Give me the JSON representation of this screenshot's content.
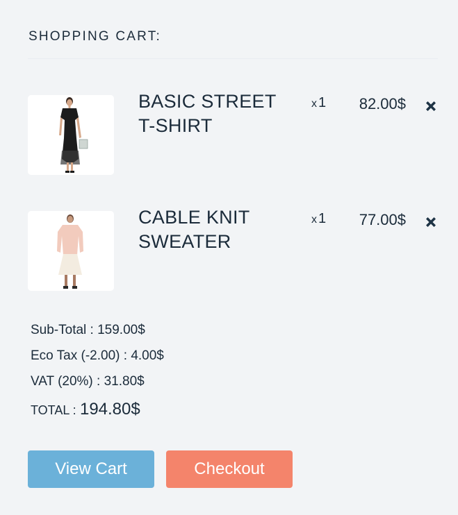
{
  "cart": {
    "title": "SHOPPING CART:",
    "items": [
      {
        "name_line1": "BASIC STREET",
        "name_line2": "T-SHIRT",
        "qty_prefix": "x",
        "qty": "1",
        "price": "82.00$",
        "remove_icon": "close-x-icon"
      },
      {
        "name_line1": "CABLE KNIT",
        "name_line2": "SWEATER",
        "qty_prefix": "x",
        "qty": "1",
        "price": "77.00$",
        "remove_icon": "close-x-icon"
      }
    ],
    "totals": {
      "subtotal_label": "Sub-Total :",
      "subtotal_value": "159.00$",
      "ecotax_label": "Eco Tax (-2.00) :",
      "ecotax_value": "4.00$",
      "vat_label": "VAT (20%) :",
      "vat_value": "31.80$",
      "total_label": "TOTAL :",
      "total_value": "194.80$"
    },
    "buttons": {
      "view_cart": "View Cart",
      "checkout": "Checkout"
    }
  },
  "colors": {
    "background": "#f2f4f6",
    "text": "#1b2b3a",
    "view_cart_button": "#6bb1d9",
    "checkout_button": "#f4846b"
  }
}
